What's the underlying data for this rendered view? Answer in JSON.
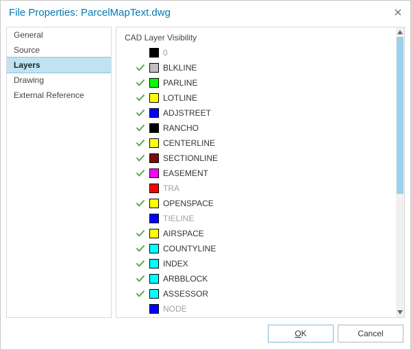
{
  "titlebar": {
    "title": "File Properties: ParcelMapText.dwg"
  },
  "sidebar": {
    "items": [
      {
        "label": "General",
        "selected": false
      },
      {
        "label": "Source",
        "selected": false
      },
      {
        "label": "Layers",
        "selected": true
      },
      {
        "label": "Drawing",
        "selected": false
      },
      {
        "label": "External Reference",
        "selected": false
      }
    ]
  },
  "main": {
    "section_title": "CAD Layer Visibility",
    "layers": [
      {
        "name": "0",
        "color": "#000000",
        "visible": false
      },
      {
        "name": "BLKLINE",
        "color": "#bfbfbf",
        "visible": true
      },
      {
        "name": "PARLINE",
        "color": "#00ff00",
        "visible": true
      },
      {
        "name": "LOTLINE",
        "color": "#ffff00",
        "visible": true
      },
      {
        "name": "ADJSTREET",
        "color": "#0000ff",
        "visible": true
      },
      {
        "name": "RANCHO",
        "color": "#000000",
        "visible": true
      },
      {
        "name": "CENTERLINE",
        "color": "#ffff00",
        "visible": true
      },
      {
        "name": "SECTIONLINE",
        "color": "#7a0c0c",
        "visible": true
      },
      {
        "name": "EASEMENT",
        "color": "#ff00ff",
        "visible": true
      },
      {
        "name": "TRA",
        "color": "#ff0000",
        "visible": false
      },
      {
        "name": "OPENSPACE",
        "color": "#ffff00",
        "visible": true
      },
      {
        "name": "TIELINE",
        "color": "#0000ff",
        "visible": false
      },
      {
        "name": "AIRSPACE",
        "color": "#ffff00",
        "visible": true
      },
      {
        "name": "COUNTYLINE",
        "color": "#00ffff",
        "visible": true
      },
      {
        "name": "INDEX",
        "color": "#00ffff",
        "visible": true
      },
      {
        "name": "ARBBLOCK",
        "color": "#00ffff",
        "visible": true
      },
      {
        "name": "ASSESSOR",
        "color": "#00ffff",
        "visible": true
      },
      {
        "name": "NODE",
        "color": "#0000ff",
        "visible": false
      }
    ]
  },
  "footer": {
    "ok_label": "OK",
    "cancel_label": "Cancel"
  }
}
